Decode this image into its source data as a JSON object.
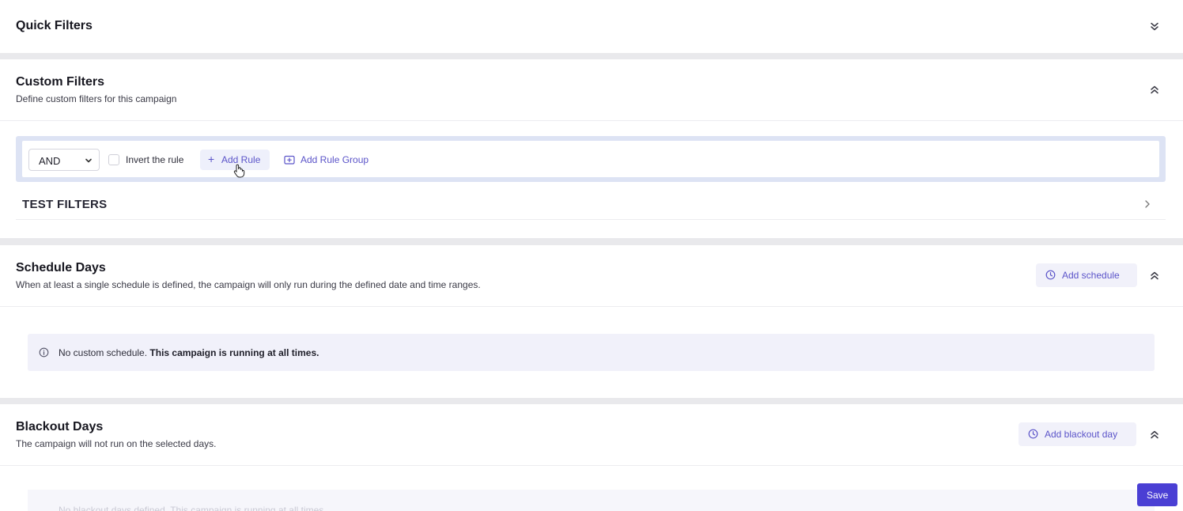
{
  "quick_filters": {
    "title": "Quick Filters",
    "toggle_icon": "chevrons-down-icon"
  },
  "custom_filters": {
    "title": "Custom Filters",
    "description": "Define custom filters for this campaign",
    "toggle_icon": "chevrons-up-icon",
    "rule_builder": {
      "operator": "AND",
      "invert_label": "Invert the rule",
      "invert_checked": false,
      "add_rule_label": "Add Rule",
      "add_rule_group_label": "Add Rule Group"
    },
    "test_filters_label": "TEST FILTERS"
  },
  "schedule_days": {
    "title": "Schedule Days",
    "description": "When at least a single schedule is defined, the campaign will only run during the defined date and time ranges.",
    "add_button": "Add schedule",
    "notice_prefix": "No custom schedule.",
    "notice_bold": "This campaign is running at all times."
  },
  "blackout_days": {
    "title": "Blackout Days",
    "description": "The campaign will not run on the selected days.",
    "add_button": "Add blackout day",
    "notice_faded": "No blackout days defined. This campaign is running at all times."
  },
  "save_label": "Save",
  "colors": {
    "accent": "#4a3fd4",
    "link": "#5b54c9",
    "panel_tint": "#f1f1fa",
    "rule_border": "#dde3f4"
  }
}
